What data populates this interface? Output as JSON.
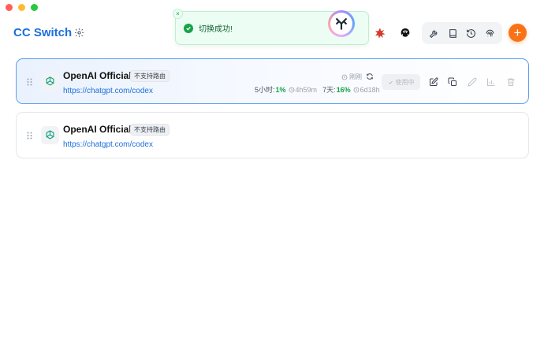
{
  "app": {
    "title": "CC Switch"
  },
  "toast": {
    "message": "切换成功!",
    "close": "×"
  },
  "toolbar": {
    "add_label": "+"
  },
  "providers": [
    {
      "name": "OpenAI Official",
      "tag": "不支持路由",
      "url": "https://chatgpt.com/codex",
      "active": true,
      "usage": {
        "refresh_label": "刚刚",
        "five_hour_label": "5小时:",
        "five_hour_pct": "1%",
        "five_hour_reset": "4h59m",
        "seven_day_label": "7天:",
        "seven_day_pct": "16%",
        "seven_day_reset": "6d18h"
      },
      "status_button": "使用中"
    },
    {
      "name": "OpenAI Official",
      "tag": "不支持路由",
      "url": "https://chatgpt.com/codex",
      "active": false
    }
  ],
  "colors": {
    "accent": "#1d6fdc",
    "success": "#16a34a",
    "add": "#f97316",
    "active_border": "#5b9df0"
  }
}
